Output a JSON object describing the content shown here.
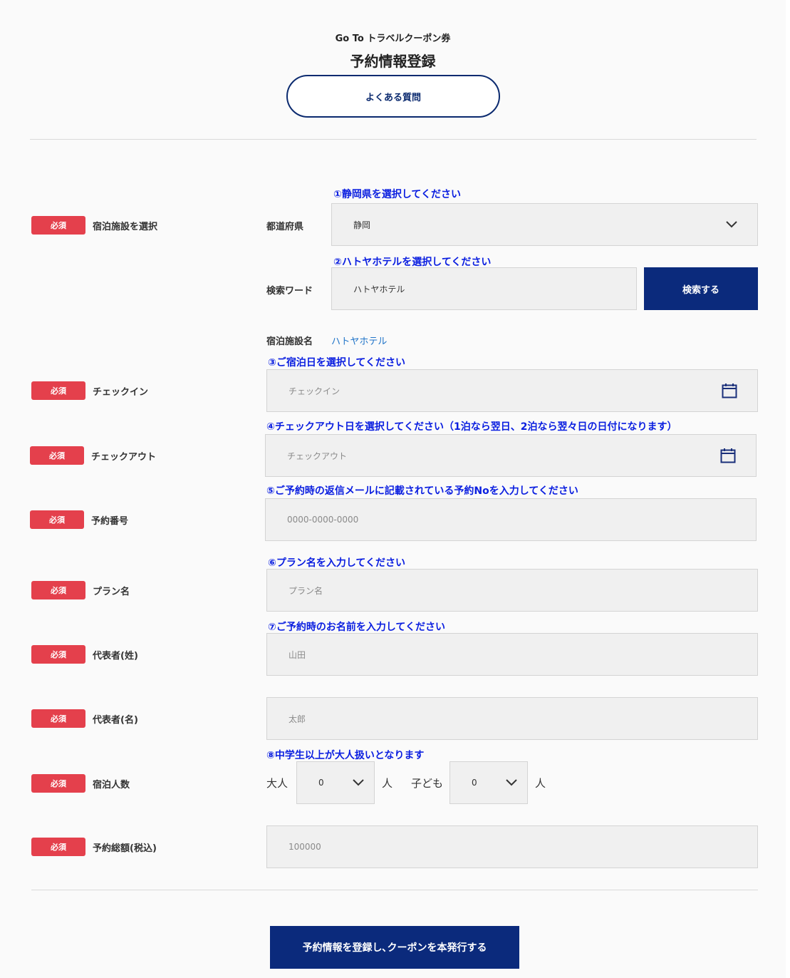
{
  "header": {
    "subtitle": "Go To トラベルクーポン券",
    "title": "予約情報登録",
    "faq_button": "よくある質問"
  },
  "required_badge": "必須",
  "facility": {
    "label": "宿泊施設を選択",
    "hint_pref": "①静岡県を選択してください",
    "pref_label": "都道府県",
    "pref_value": "静岡",
    "hint_search": "②ハトヤホテルを選択してください",
    "search_label": "検索ワード",
    "search_value": "ハトヤホテル",
    "search_button": "検索する",
    "name_label": "宿泊施設名",
    "name_value": "ハトヤホテル"
  },
  "checkin": {
    "hint": "③ご宿泊日を選択してください",
    "label": "チェックイン",
    "placeholder": "チェックイン"
  },
  "checkout": {
    "hint": "④チェックアウト日を選択してください（1泊なら翌日、2泊なら翌々日の日付になります）",
    "label": "チェックアウト",
    "placeholder": "チェックアウト"
  },
  "reservation_no": {
    "hint": "⑤ご予約時の返信メールに記載されている予約Noを入力してください",
    "label": "予約番号",
    "placeholder": "0000-0000-0000"
  },
  "plan": {
    "hint": "⑥プラン名を入力してください",
    "label": "プラン名",
    "placeholder": "プラン名"
  },
  "rep_last": {
    "hint": "⑦ご予約時のお名前を入力してください",
    "label": "代表者(姓)",
    "placeholder": "山田"
  },
  "rep_first": {
    "label": "代表者(名)",
    "placeholder": "太郎"
  },
  "guests": {
    "hint": "⑧中学生以上が大人扱いとなります",
    "label": "宿泊人数",
    "adult_label": "大人",
    "adult_value": "0",
    "adult_unit": "人",
    "child_label": "子ども",
    "child_value": "0",
    "child_unit": "人"
  },
  "total": {
    "label": "予約総額(税込)",
    "placeholder": "100000"
  },
  "submit_button": "予約情報を登録し､クーポンを本発行する",
  "colors": {
    "navy": "#0b2a7c",
    "required_red": "#e4404c",
    "hint_blue": "#0a1ee0",
    "link_blue": "#1e73c8"
  }
}
